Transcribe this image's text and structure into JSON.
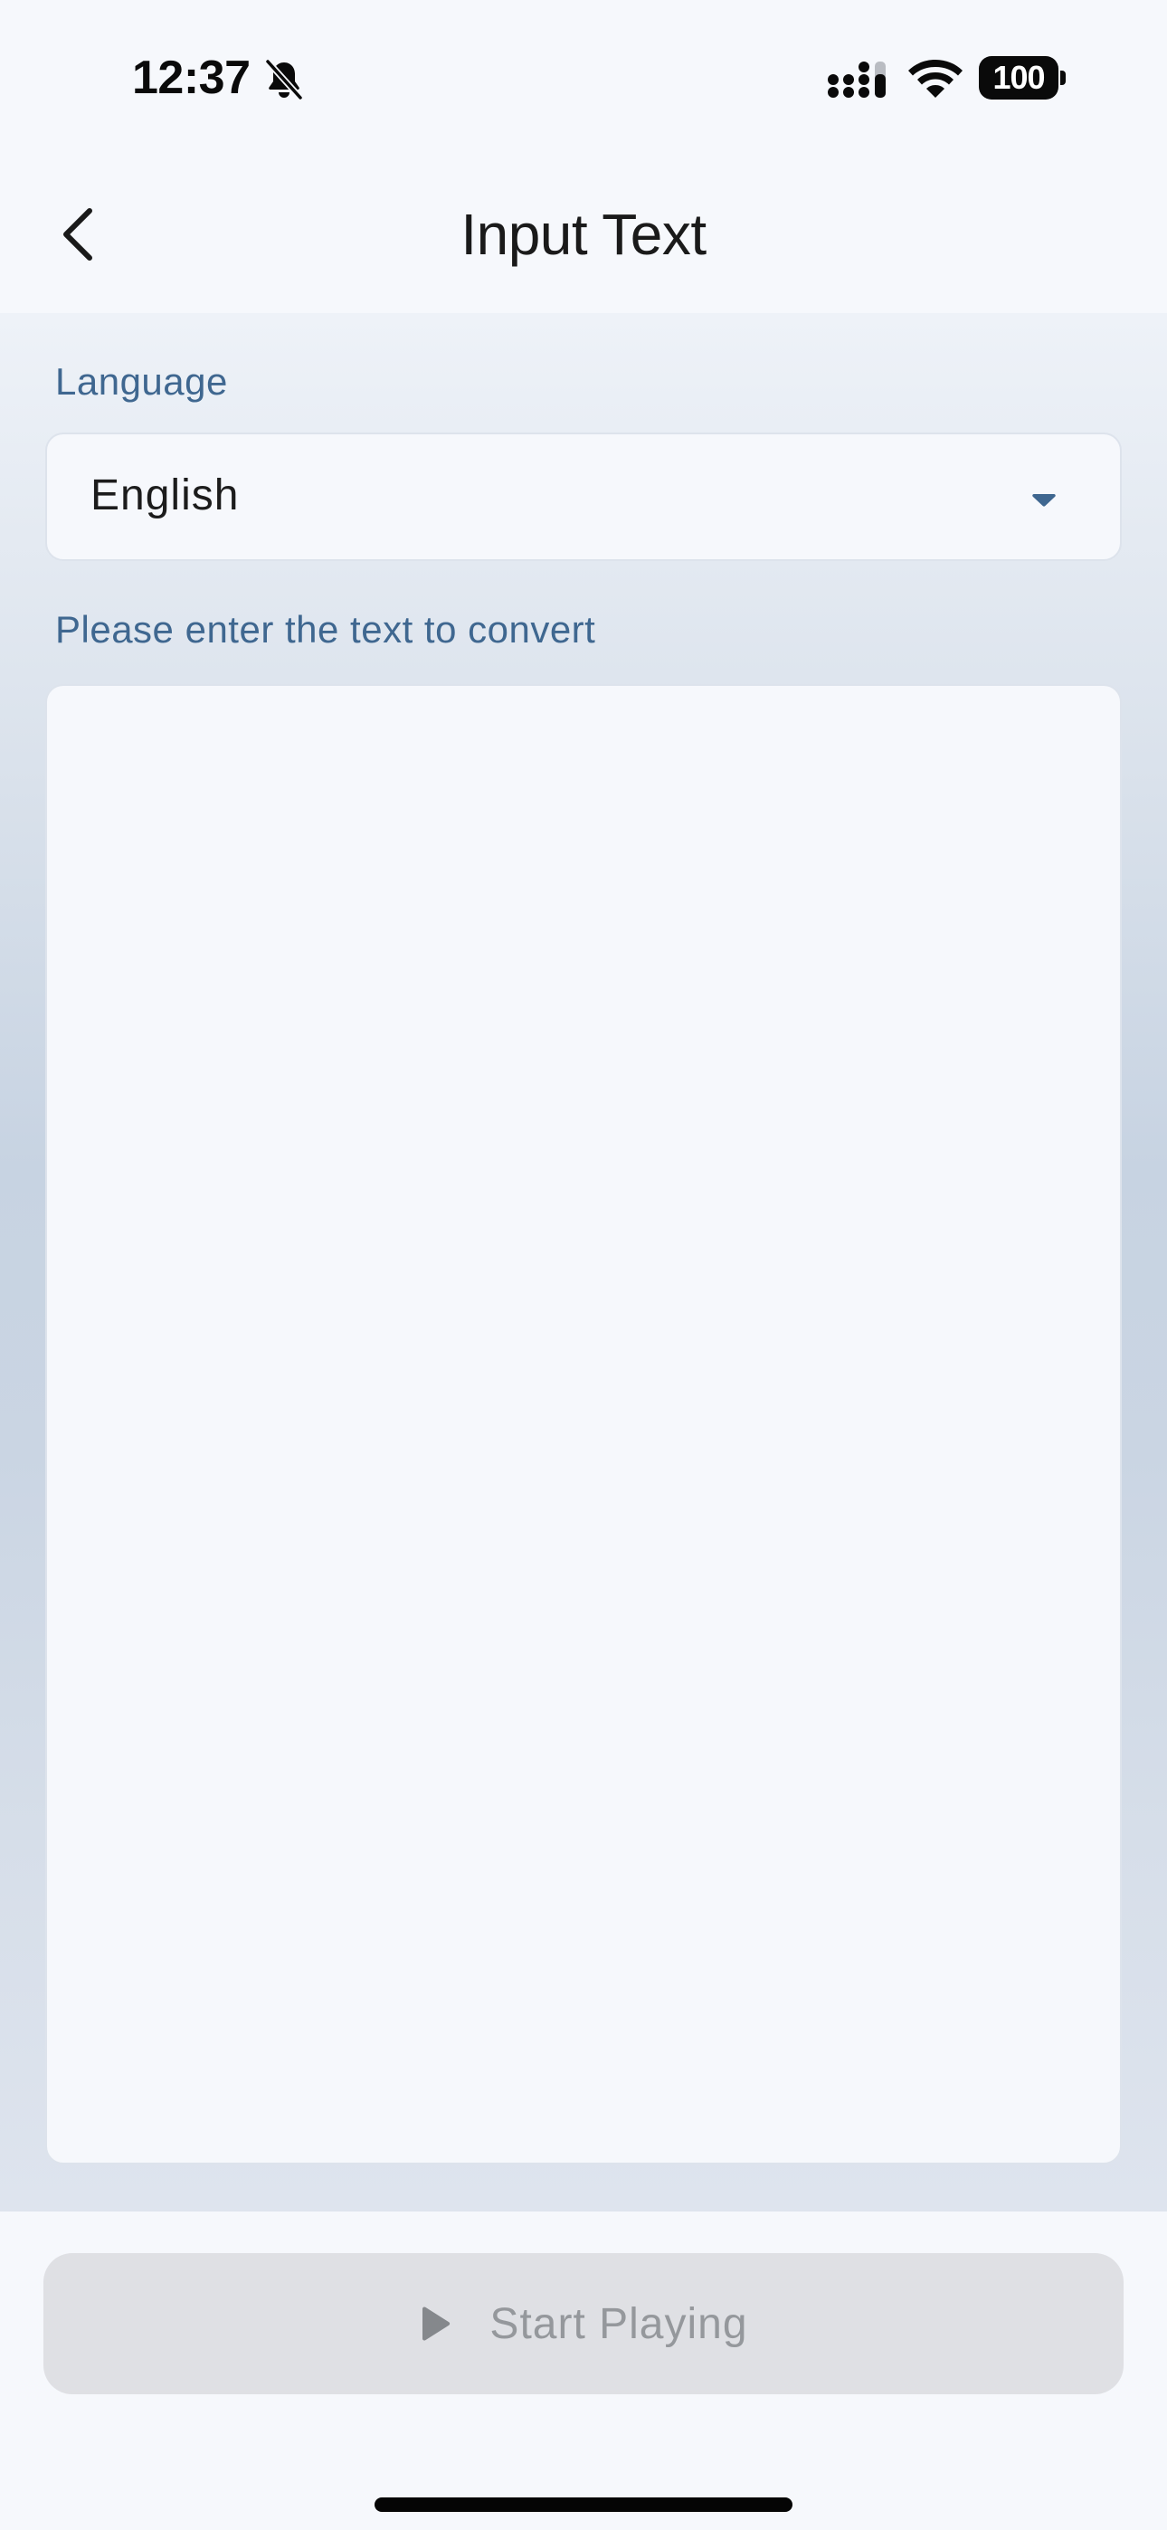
{
  "status_bar": {
    "time": "12:37",
    "battery_level": "100",
    "icons": [
      "bell-slash-icon",
      "cellular-signal-icon",
      "wifi-icon",
      "battery-icon"
    ]
  },
  "header": {
    "title": "Input Text",
    "back_icon": "chevron-left-icon"
  },
  "form": {
    "language_label": "Language",
    "language_value": "English",
    "dropdown_icon": "caret-down-icon",
    "input_label": "Please enter the text to convert",
    "input_value": ""
  },
  "footer": {
    "start_label": "Start Playing",
    "play_icon": "play-icon"
  },
  "colors": {
    "label_blue": "#3f6790",
    "caret_blue": "#3f6790",
    "disabled_button_bg": "#dfe0e4",
    "disabled_button_text": "#95989c"
  }
}
